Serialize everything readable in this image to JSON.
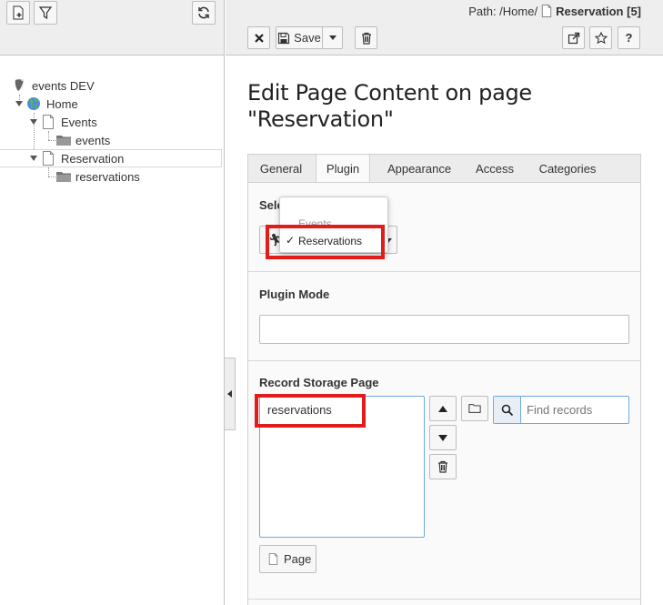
{
  "tree": {
    "toolbar": {
      "new_page_icon": "new-page-icon",
      "filter_icon": "filter-icon",
      "refresh_icon": "refresh-icon"
    },
    "root": "events DEV",
    "nodes": [
      {
        "label": "Home"
      },
      {
        "label": "Events"
      },
      {
        "label": "events"
      },
      {
        "label": "Reservation"
      },
      {
        "label": "reservations"
      }
    ]
  },
  "header": {
    "path_label": "Path: /Home/",
    "current_page": "Reservation [5]",
    "save_label": "Save"
  },
  "page_title": "Edit Page Content on page \"Reservation\"",
  "tabs": [
    "General",
    "Plugin",
    "Appearance",
    "Access",
    "Categories"
  ],
  "plugin": {
    "select_label_visible": "Sele",
    "dropdown_options": [
      "Events",
      "Reservations"
    ],
    "selected_option": "Reservations",
    "plugin_mode_label": "Plugin Mode",
    "plugin_mode_value": ""
  },
  "storage": {
    "label": "Record Storage Page",
    "items": [
      "reservations"
    ],
    "find_placeholder": "Find records",
    "page_button": "Page"
  },
  "colors": {
    "highlight": "#e21b1b",
    "header_bg": "#eeeeee",
    "focus_border": "#6daae0"
  }
}
